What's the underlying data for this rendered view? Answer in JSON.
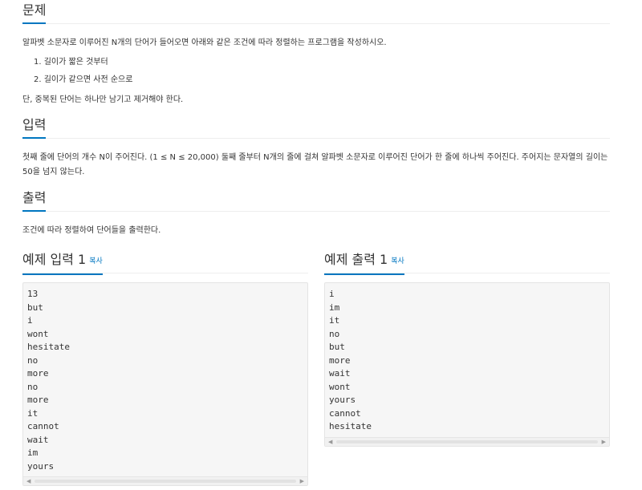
{
  "problem": {
    "title": "문제",
    "description": "알파벳 소문자로 이루어진 N개의 단어가 들어오면 아래와 같은 조건에 따라 정렬하는 프로그램을 작성하시오.",
    "conditions": [
      "1. 길이가 짧은 것부터",
      "2. 길이가 같으면 사전 순으로"
    ],
    "note": "단, 중복된 단어는 하나만 남기고 제거해야 한다."
  },
  "input": {
    "title": "입력",
    "description": "첫째 줄에 단어의 개수 N이 주어진다. (1 ≤ N ≤ 20,000) 둘째 줄부터 N개의 줄에 걸쳐 알파벳 소문자로 이루어진 단어가 한 줄에 하나씩 주어진다. 주어지는 문자열의 길이는 50을 넘지 않는다."
  },
  "output": {
    "title": "출력",
    "description": "조건에 따라 정렬하여 단어들을 출력한다."
  },
  "sample_input": {
    "title": "예제 입력 1",
    "copy_label": "복사",
    "lines": [
      "13",
      "but",
      "i",
      "wont",
      "hesitate",
      "no",
      "more",
      "no",
      "more",
      "it",
      "cannot",
      "wait",
      "im",
      "yours"
    ]
  },
  "sample_output": {
    "title": "예제 출력 1",
    "copy_label": "복사",
    "lines": [
      "i",
      "im",
      "it",
      "no",
      "but",
      "more",
      "wait",
      "wont",
      "yours",
      "cannot",
      "hesitate"
    ]
  },
  "scroll_arrows": {
    "left": "◀",
    "right": "▶"
  }
}
